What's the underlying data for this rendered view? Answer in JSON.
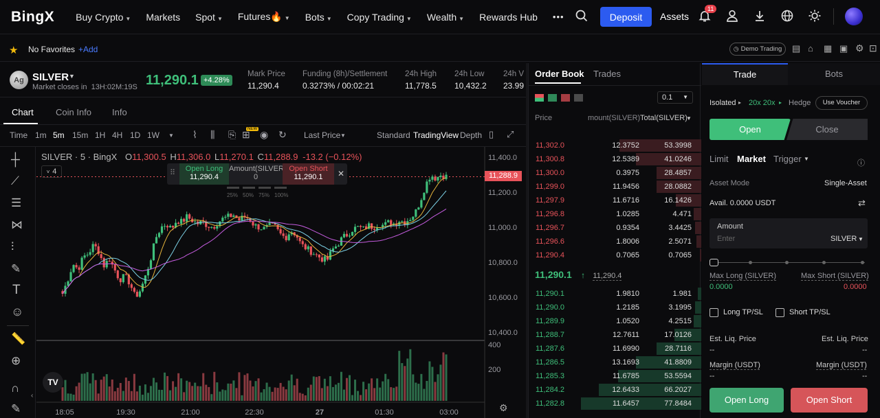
{
  "nav": {
    "logo": "BingX",
    "items": [
      {
        "label": "Buy Crypto",
        "caret": true
      },
      {
        "label": "Markets",
        "caret": false
      },
      {
        "label": "Spot",
        "caret": true
      },
      {
        "label": "Futures🔥",
        "caret": true
      },
      {
        "label": "Bots",
        "caret": true
      },
      {
        "label": "Copy Trading",
        "caret": true
      },
      {
        "label": "Wealth",
        "caret": true
      },
      {
        "label": "Rewards Hub",
        "caret": false
      }
    ],
    "more": "•••",
    "deposit": "Deposit",
    "assets": "Assets",
    "notification_count": "11"
  },
  "favorites": {
    "none": "No Favorites",
    "add": "+Add",
    "demo": "Demo Trading"
  },
  "ticker": {
    "symbol_icon": "Ag",
    "symbol": "SILVER",
    "market_closes": "Market closes in  13H:02M:19S",
    "price": "11,290.1",
    "change": "+4.28%",
    "stats": [
      {
        "label": "Mark Price",
        "value": "11,290.4"
      },
      {
        "label": "Funding (8h)/Settlement",
        "value": "0.3273% / 00:02:21"
      },
      {
        "label": "24h High",
        "value": "11,778.5"
      },
      {
        "label": "24h Low",
        "value": "10,432.2"
      },
      {
        "label": "24h V",
        "value": "23.99"
      }
    ]
  },
  "chart_panel": {
    "tabs": [
      "Chart",
      "Coin Info",
      "Info"
    ],
    "toolbar": {
      "time": "Time",
      "intervals": [
        "1m",
        "5m",
        "15m",
        "1H",
        "4H",
        "1D",
        "1W"
      ],
      "active_interval": "5m",
      "price_type": "Last Price",
      "views": [
        "Standard",
        "TradingView",
        "Depth"
      ],
      "new_badge": "NEW"
    },
    "legend": {
      "title": "SILVER · 5 · BingX",
      "o_label": "O",
      "o": "11,300.5",
      "h_label": "H",
      "h": "11,306.0",
      "l_label": "L",
      "l": "11,270.1",
      "c_label": "C",
      "c": "11,288.9",
      "chg": "-13.2 (−0.12%)",
      "indicator_count": "4"
    },
    "quick_order": {
      "long_label": "Open Long",
      "long_price": "11,290.4",
      "amount_label": "Amount(SILVER)",
      "amount": "0",
      "short_label": "Open Short",
      "short_price": "11,290.1",
      "pcts": [
        "25%",
        "50%",
        "75%",
        "100%"
      ]
    },
    "last_price_tag": "11,288.9",
    "tv_badge": "TV"
  },
  "chart_data": {
    "type": "candlestick",
    "x_ticks": [
      "18:05",
      "19:30",
      "21:00",
      "22:30",
      "27",
      "01:30",
      "03:00"
    ],
    "price_ticks": [
      "11,400.0",
      "11,200.0",
      "11,000.0",
      "10,800.0",
      "10,600.0",
      "10,400.0"
    ],
    "volume_ticks": [
      "400",
      "200"
    ],
    "ylim": [
      10380,
      11440
    ],
    "last_price": 11288.9,
    "closes": [
      10620,
      10700,
      10790,
      10760,
      10830,
      10850,
      10900,
      10860,
      10780,
      10820,
      10760,
      10700,
      10720,
      10680,
      10600,
      10640,
      10720,
      10820,
      10940,
      11000,
      11020,
      10990,
      11040,
      11030,
      11060,
      11040,
      11020,
      11030,
      11010,
      11000,
      11030,
      11050,
      11060,
      11070,
      11040,
      11060,
      11050,
      11010,
      11000,
      10990,
      11010,
      11000,
      10960,
      10940,
      10980,
      10960,
      10900,
      10880,
      10860,
      10840,
      10820,
      10810,
      10870,
      10900,
      10940,
      10960,
      10990,
      11000,
      10990,
      11010,
      11000,
      11020,
      11010,
      11030,
      11020,
      11040,
      11030,
      11050,
      11080,
      11150,
      11240,
      11300,
      11280,
      11300,
      11290
    ]
  },
  "orderbook": {
    "tabs": [
      "Order Book",
      "Trades"
    ],
    "precision": "0.1",
    "headers": [
      "Price",
      "mount(SILVER)",
      "Total(SILVER)"
    ],
    "asks": [
      {
        "price": "11,302.0",
        "amount": "12.3752",
        "total": "53.3998",
        "depth": 0.68
      },
      {
        "price": "11,300.8",
        "amount": "12.5389",
        "total": "41.0246",
        "depth": 0.54
      },
      {
        "price": "11,300.0",
        "amount": "0.3975",
        "total": "28.4857",
        "depth": 0.37
      },
      {
        "price": "11,299.0",
        "amount": "11.9456",
        "total": "28.0882",
        "depth": 0.37
      },
      {
        "price": "11,297.9",
        "amount": "11.6716",
        "total": "16.1426",
        "depth": 0.21
      },
      {
        "price": "11,296.8",
        "amount": "1.0285",
        "total": "4.471",
        "depth": 0.06
      },
      {
        "price": "11,296.7",
        "amount": "0.9354",
        "total": "3.4425",
        "depth": 0.05
      },
      {
        "price": "11,296.6",
        "amount": "1.8006",
        "total": "2.5071",
        "depth": 0.04
      },
      {
        "price": "11,290.4",
        "amount": "0.7065",
        "total": "0.7065",
        "depth": 0.01
      }
    ],
    "mid_price": "11,290.1",
    "mid_mark": "11,290.4",
    "bids": [
      {
        "price": "11,290.1",
        "amount": "1.9810",
        "total": "1.981",
        "depth": 0.03
      },
      {
        "price": "11,290.0",
        "amount": "1.2185",
        "total": "3.1995",
        "depth": 0.05
      },
      {
        "price": "11,289.9",
        "amount": "1.0520",
        "total": "4.2515",
        "depth": 0.06
      },
      {
        "price": "11,288.7",
        "amount": "12.7611",
        "total": "17.0126",
        "depth": 0.22
      },
      {
        "price": "11,287.6",
        "amount": "11.6990",
        "total": "28.7116",
        "depth": 0.37
      },
      {
        "price": "11,286.5",
        "amount": "13.1693",
        "total": "41.8809",
        "depth": 0.54
      },
      {
        "price": "11,285.3",
        "amount": "11.6785",
        "total": "53.5594",
        "depth": 0.69
      },
      {
        "price": "11,284.2",
        "amount": "12.6433",
        "total": "66.2027",
        "depth": 0.85
      },
      {
        "price": "11,282.8",
        "amount": "11.6457",
        "total": "77.8484",
        "depth": 1.0
      }
    ]
  },
  "trade": {
    "tabs": [
      "Trade",
      "Bots"
    ],
    "margin_mode": "Isolated",
    "leverage": "20x 20x",
    "hedge": "Hedge",
    "voucher": "Use Voucher",
    "open": "Open",
    "close": "Close",
    "order_types": [
      "Limit",
      "Market",
      "Trigger"
    ],
    "asset_mode_label": "Asset Mode",
    "asset_mode": "Single-Asset",
    "avail": "Avail. 0.0000 USDT",
    "amount_label": "Amount",
    "amount_placeholder": "Enter",
    "amount_unit": "SILVER",
    "max_long_label": "Max Long (SILVER)",
    "max_long": "0.0000",
    "max_short_label": "Max Short (SILVER)",
    "max_short": "0.0000",
    "long_tpsl": "Long TP/SL",
    "short_tpsl": "Short TP/SL",
    "est_liq_label": "Est. Liq. Price",
    "est_liq_value": "--",
    "margin_label": "Margin (USDT)",
    "margin_value": "--",
    "open_long": "Open Long",
    "open_short": "Open Short"
  },
  "colors": {
    "up": "#3fbf7a",
    "down": "#e8535a",
    "accent": "#2c5bf0",
    "ma1": "#e6b43c",
    "ma2": "#7dd3e8",
    "ma3": "#c65de0"
  }
}
